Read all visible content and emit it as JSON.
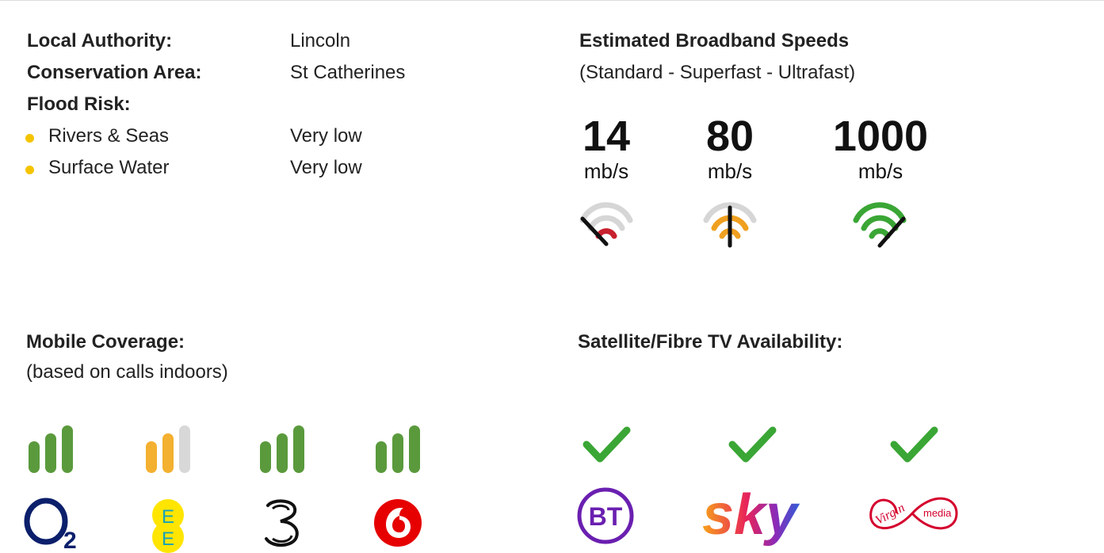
{
  "local_info": {
    "local_authority_label": "Local Authority:",
    "local_authority_value": "Lincoln",
    "conservation_area_label": "Conservation Area:",
    "conservation_area_value": "St Catherines",
    "flood_risk_label": "Flood Risk:",
    "flood_items": [
      {
        "label": "Rivers & Seas",
        "value": "Very low"
      },
      {
        "label": "Surface Water",
        "value": "Very low"
      }
    ],
    "bullet_color": "#f5c400"
  },
  "broadband": {
    "title": "Estimated Broadband Speeds",
    "subtitle": "(Standard - Superfast - Ultrafast)",
    "speeds": [
      {
        "value": "14",
        "unit": "mb/s",
        "color": "#c8202e",
        "icon": "speed-gauge-low-icon"
      },
      {
        "value": "80",
        "unit": "mb/s",
        "color": "#f0a020",
        "icon": "speed-gauge-mid-icon"
      },
      {
        "value": "1000",
        "unit": "mb/s",
        "color": "#3aa635",
        "icon": "speed-gauge-high-icon"
      }
    ]
  },
  "mobile": {
    "title": "Mobile Coverage:",
    "subtitle": "(based on calls indoors)",
    "operators": [
      {
        "name": "O2",
        "bars_filled": 3,
        "bar_color": "#5a9a3c",
        "icon": "o2-logo-icon"
      },
      {
        "name": "EE",
        "bars_filled": 2,
        "bar_color": "#f4b030",
        "icon": "ee-logo-icon"
      },
      {
        "name": "Three",
        "bars_filled": 3,
        "bar_color": "#5a9a3c",
        "icon": "three-logo-icon"
      },
      {
        "name": "Vodafone",
        "bars_filled": 3,
        "bar_color": "#5a9a3c",
        "icon": "vodafone-logo-icon"
      }
    ],
    "empty_bar_color": "#d8d8d8"
  },
  "tv": {
    "title": "Satellite/Fibre TV Availability:",
    "providers": [
      {
        "name": "BT",
        "available": true,
        "icon": "bt-logo-icon"
      },
      {
        "name": "sky",
        "available": true,
        "icon": "sky-logo-icon"
      },
      {
        "name": "Virgin media",
        "available": true,
        "icon": "virgin-media-logo-icon"
      }
    ],
    "check_color": "#3aa635"
  }
}
